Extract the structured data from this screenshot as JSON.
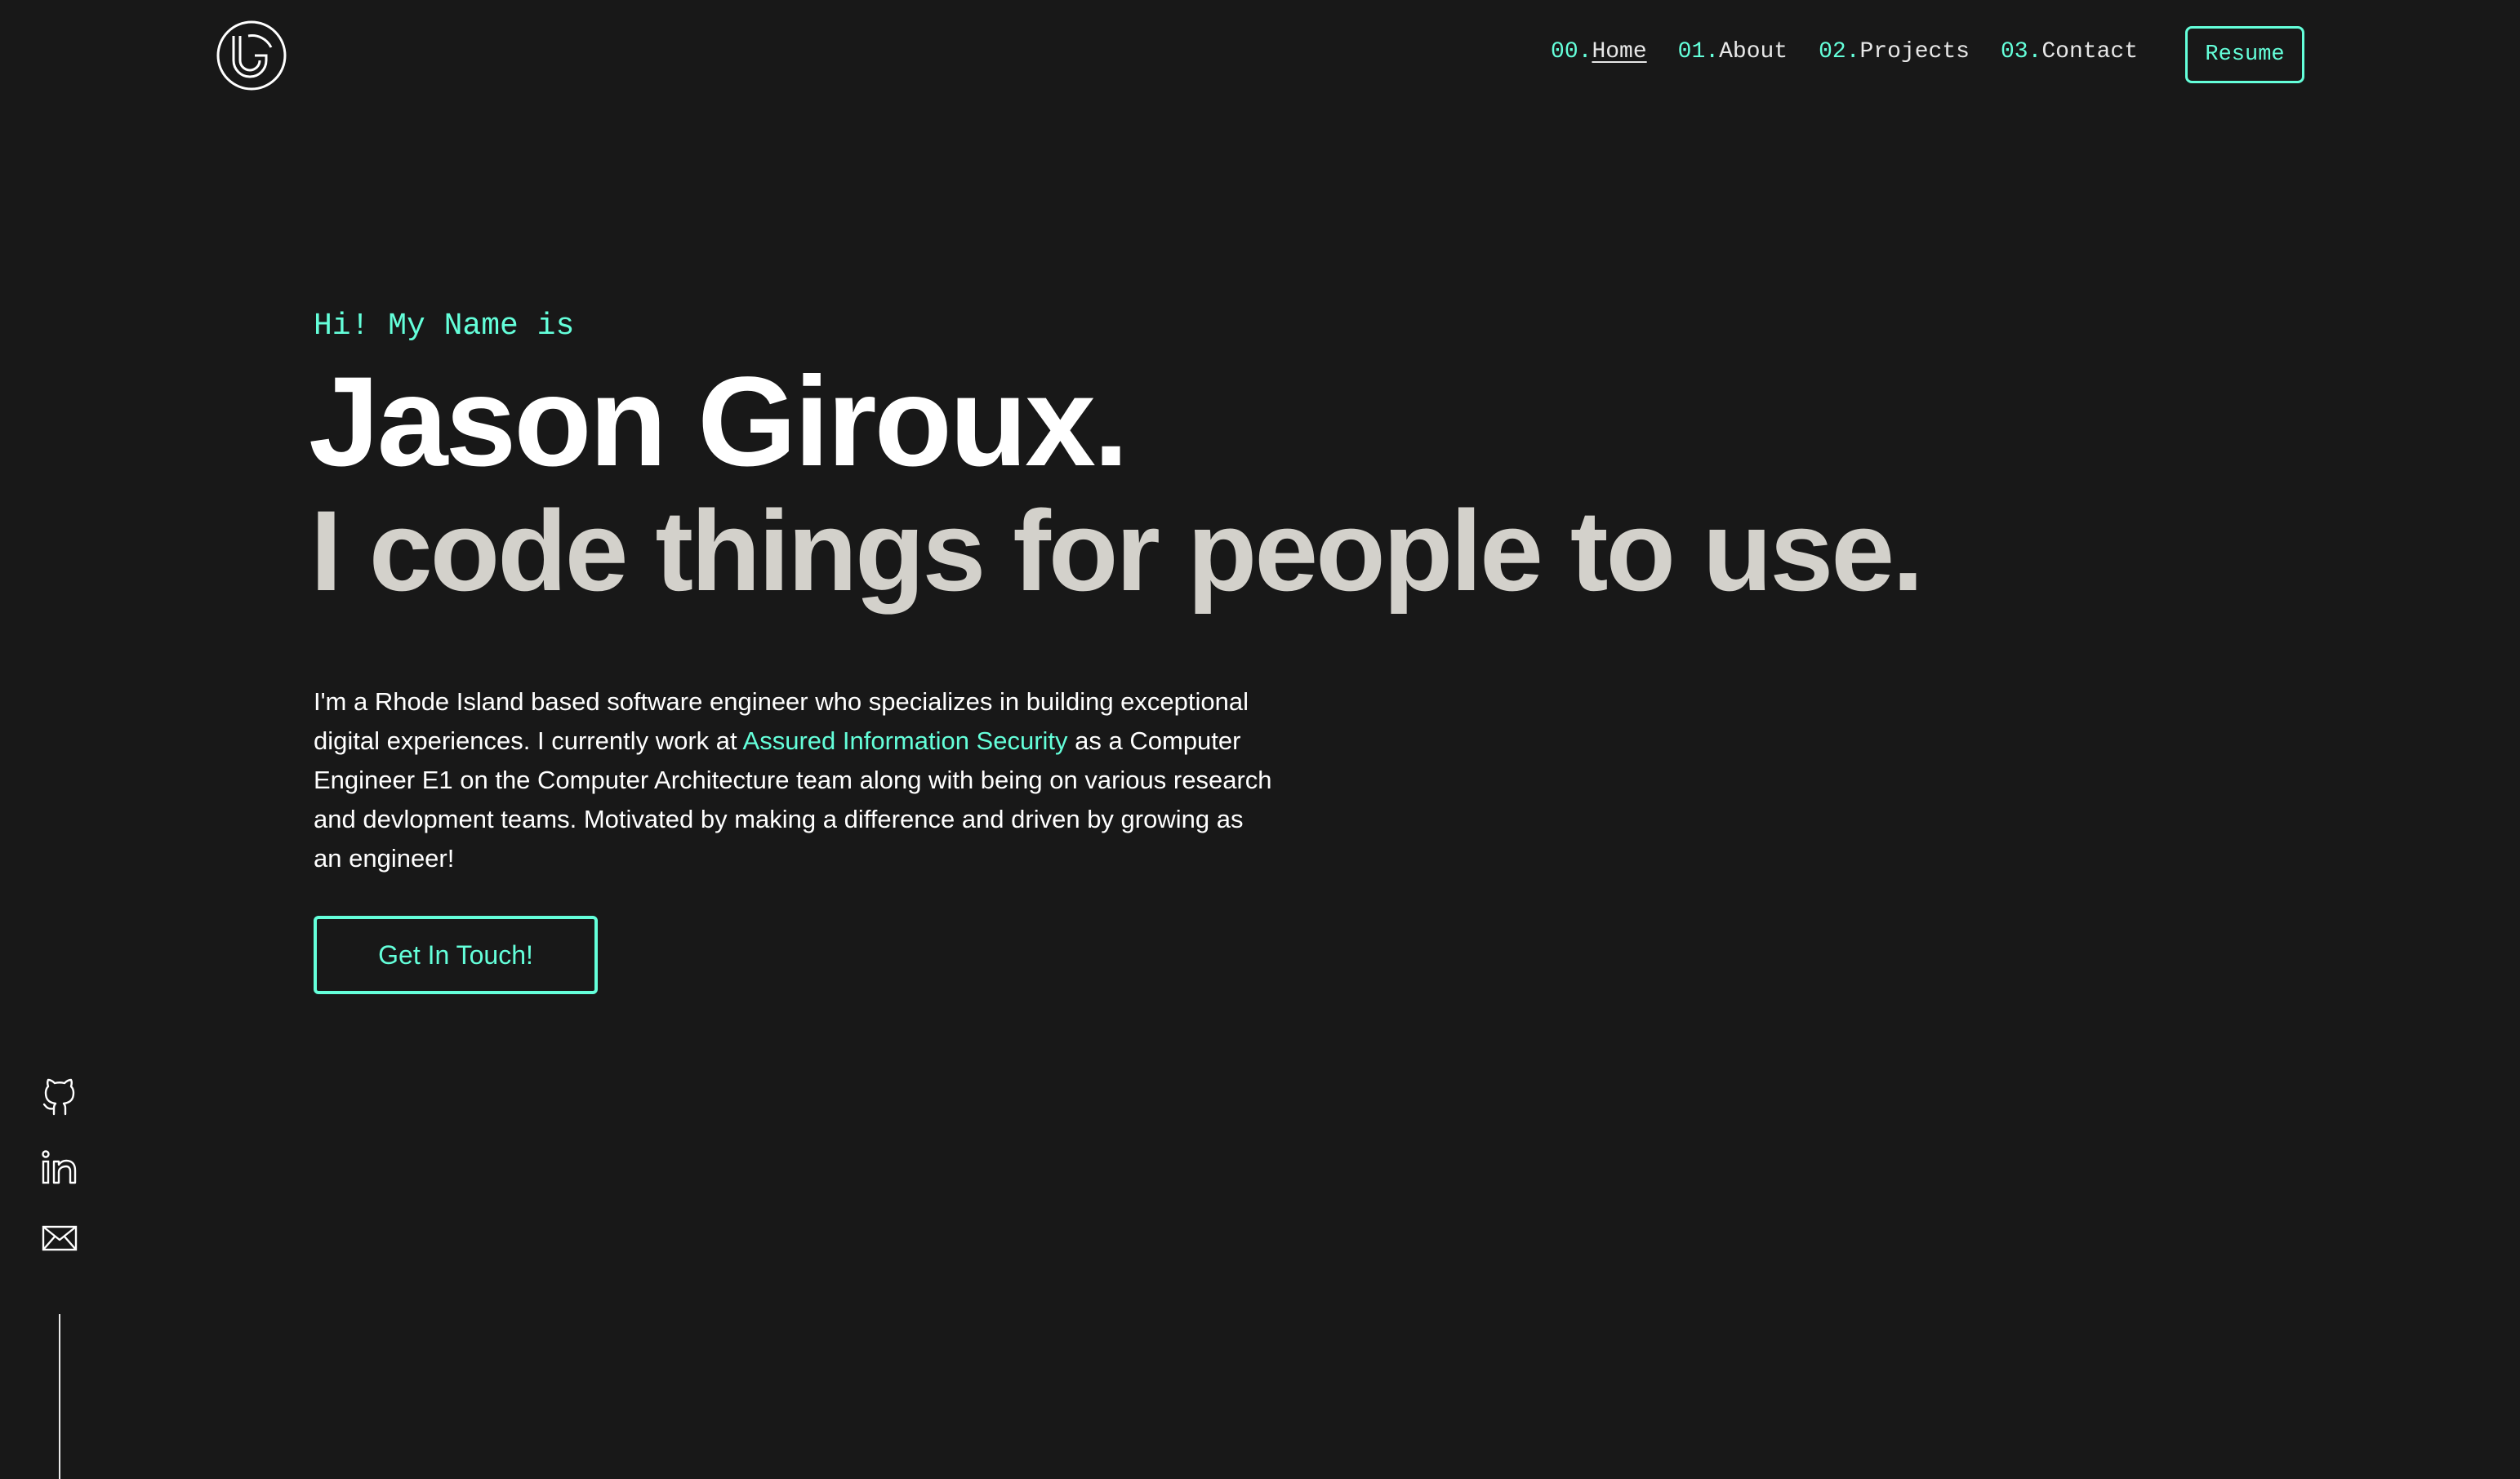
{
  "header": {
    "logo_icon": "jg-monogram-icon",
    "nav": [
      {
        "num": "00.",
        "label": "Home",
        "active": true
      },
      {
        "num": "01.",
        "label": "About"
      },
      {
        "num": "02.",
        "label": "Projects"
      },
      {
        "num": "03.",
        "label": "Contact"
      }
    ],
    "resume_label": "Resume"
  },
  "hero": {
    "greeting": "Hi! My Name is",
    "name": "Jason Giroux.",
    "tagline": "I code things for people to use.",
    "bio_part1": "I'm a Rhode Island based software engineer who specializes in building exceptional digital experiences. I currently work at ",
    "bio_link": "Assured Information Security",
    "bio_part2": " as a Computer Engineer E1 on the Computer Architecture team along with being on various research and devlopment teams. Motivated by making a difference and driven by growing as an engineer!",
    "cta_label": "Get In Touch!"
  },
  "socials": [
    {
      "icon": "github-icon"
    },
    {
      "icon": "linkedin-icon"
    },
    {
      "icon": "mail-icon"
    }
  ],
  "colors": {
    "background": "#181818",
    "accent": "#64ffda",
    "text": "#ffffff",
    "tagline": "#d3d1cb"
  }
}
